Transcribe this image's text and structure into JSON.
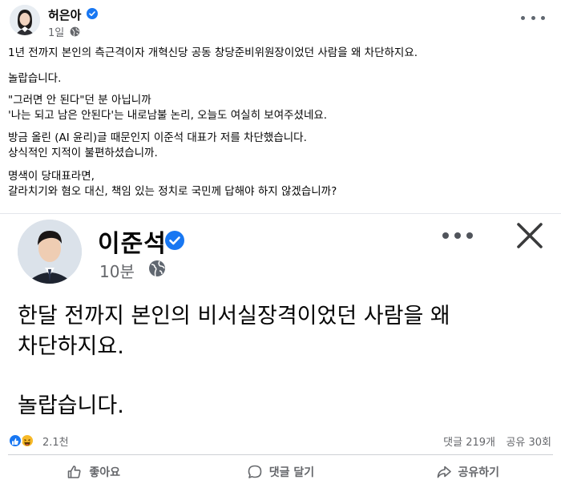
{
  "outer_post": {
    "author": "허은아",
    "time": "1일",
    "paragraphs": [
      [
        "1년 전까지 본인의 측근격이자 개혁신당 공동 창당준비위원장이었던 사람을 왜 차단하지요."
      ],
      [
        "놀랍습니다."
      ],
      [
        "\"그러면 안 된다\"던 분 아닙니까",
        "'나는 되고 남은 안된다'는 내로남불 논리, 오늘도 여실히 보여주셨네요."
      ],
      [
        "방금 올린 (AI 윤리)글 때문인지 이준석 대표가 저를 차단했습니다.",
        "상식적인 지적이 불편하셨습니까."
      ],
      [
        "명색이 당대표라면,",
        "갈라치기와 혐오 대신, 책임 있는 정치로 국민께 답해야 하지 않겠습니까?"
      ]
    ]
  },
  "embedded_post": {
    "author": "이준석",
    "time": "10분",
    "body_lines": [
      "한달 전까지 본인의 비서실장격이었던 사람을 왜",
      "차단하지요.",
      "",
      "놀랍습니다."
    ]
  },
  "stats": {
    "reactions": "2.1천",
    "comments": "댓글 219개",
    "shares": "공유 30회"
  },
  "actions": {
    "like": "좋아요",
    "comment": "댓글 달기",
    "share": "공유하기"
  },
  "colors": {
    "verified": "#1877f2",
    "secondary_text": "#65676b"
  }
}
